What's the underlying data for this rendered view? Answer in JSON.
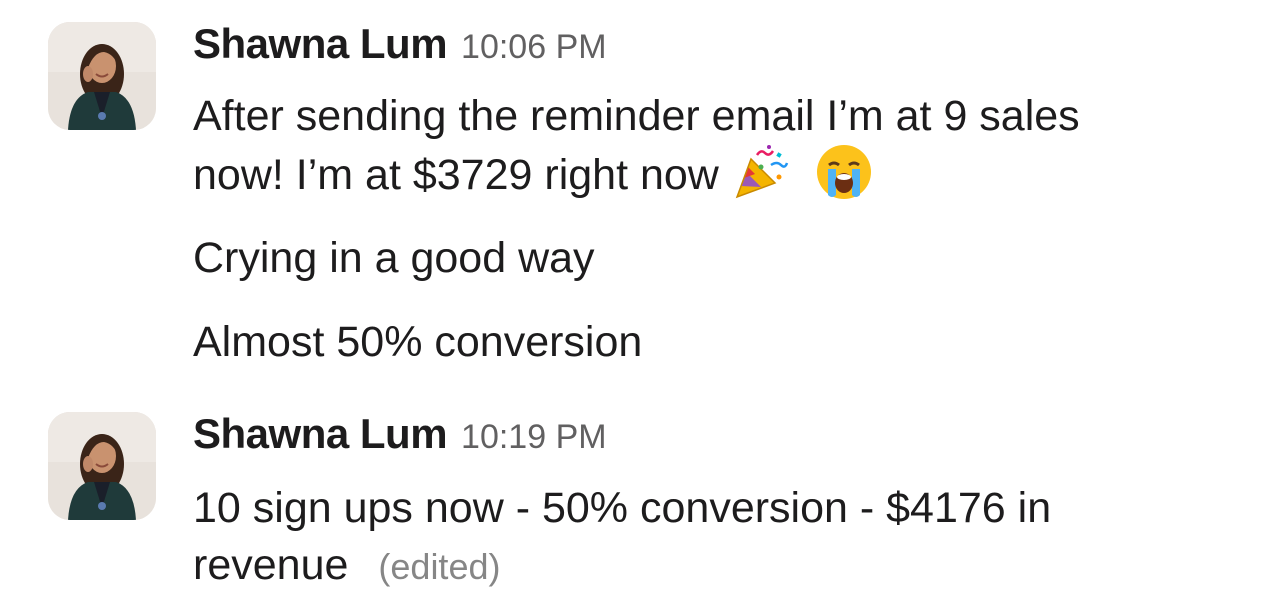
{
  "messages": [
    {
      "sender": "Shawna Lum",
      "time": "10:06 PM",
      "avatar_icon": "user-photo-avatar",
      "lines": [
        "After sending the reminder email I’m at 9 sales",
        "now! I’m at $3729 right now",
        "Crying in a good way",
        "Almost 50% conversion"
      ],
      "emojis": [
        "party-popper-emoji",
        "loudly-crying-face-emoji"
      ]
    },
    {
      "sender": "Shawna Lum",
      "time": "10:19 PM",
      "avatar_icon": "user-photo-avatar",
      "lines": [
        "10 sign ups now - 50% conversion - $4176 in",
        "revenue"
      ],
      "edited_label": "(edited)"
    }
  ],
  "colors": {
    "text": "#1d1c1d",
    "timestamp": "#616061",
    "edited": "#868686",
    "background": "#ffffff"
  }
}
